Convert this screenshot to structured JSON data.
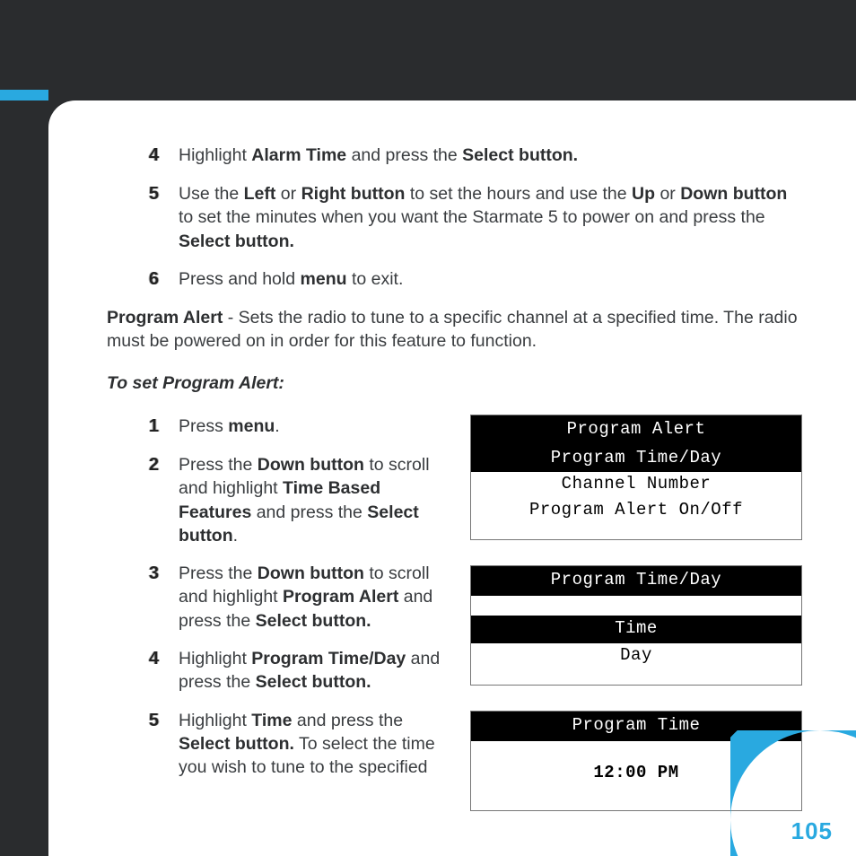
{
  "page_number": "105",
  "top_steps": [
    {
      "n": "4",
      "html": "Highlight <b>Alarm Time</b> and press the <b>Select button.</b>"
    },
    {
      "n": "5",
      "html": "Use the <b>Left</b> or <b>Right button</b> to set the hours and use the <b>Up</b> or <b>Down button</b> to set the minutes when you want the Starmate 5 to power on and press the <b>Select button.</b>"
    },
    {
      "n": "6",
      "html": "Press and hold <b>menu</b> to exit."
    }
  ],
  "program_alert_para": "<b>Program Alert</b> - Sets the radio to tune to a specific channel at a specified time. The radio must be powered on in order for this feature to function.",
  "subtitle": "To set Program Alert:",
  "pa_steps": [
    {
      "n": "1",
      "html": "Press <b>menu</b>."
    },
    {
      "n": "2",
      "html": "Press the <b>Down button</b> to scroll and highlight <b>Time Based Features</b> and press the <b>Select button</b>."
    },
    {
      "n": "3",
      "html": "Press the <b>Down button</b> to scroll and highlight <b>Program Alert</b> and press the <b>Select button.</b>"
    },
    {
      "n": "4",
      "html": "Highlight <b>Program Time/Day</b> and press the <b>Select button.</b>"
    },
    {
      "n": "5",
      "html": "Highlight <b>Time</b> and press the <b>Select button.</b> To select the time you wish to tune to the specified"
    }
  ],
  "screens": {
    "s1": {
      "title": "Program Alert",
      "rows": [
        {
          "text": "Program Time/Day",
          "hi": true
        },
        {
          "text": "Channel Number",
          "hi": false
        },
        {
          "text": "Program Alert On/Off",
          "hi": false
        }
      ]
    },
    "s2": {
      "title": "Program Time/Day",
      "rows": [
        {
          "text": "",
          "hi": false,
          "blank": true
        },
        {
          "text": "Time",
          "hi": true
        },
        {
          "text": "Day",
          "hi": false
        }
      ]
    },
    "s3": {
      "title": "Program Time",
      "rows": [
        {
          "text": "",
          "hi": false,
          "blank": true
        },
        {
          "text": "12:00 PM",
          "hi": false
        }
      ]
    }
  }
}
